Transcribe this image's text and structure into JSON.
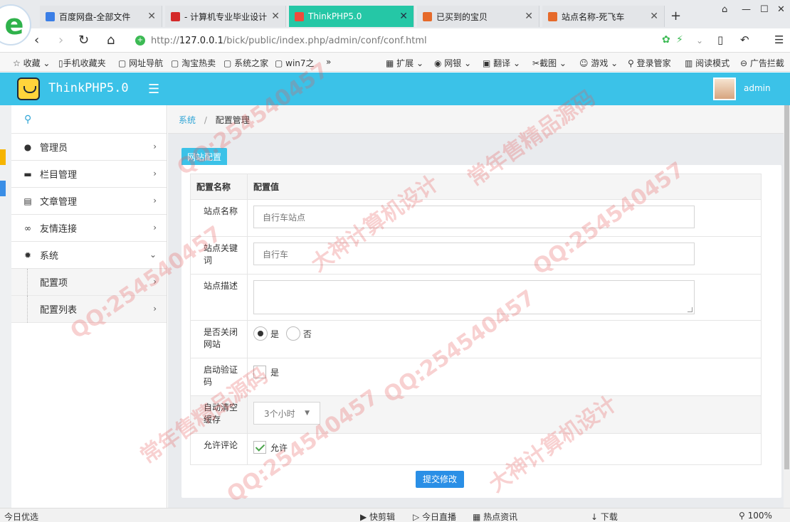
{
  "browser": {
    "tabs": [
      {
        "label": "百度网盘-全部文件",
        "icon": "cloud-icon",
        "active": false
      },
      {
        "label": "- 计算机专业毕业设计",
        "icon": "site-icon",
        "active": false
      },
      {
        "label": "ThinkPHP5.0",
        "icon": "thinkphp-icon",
        "active": true
      },
      {
        "label": "已买到的宝贝",
        "icon": "taobao-icon",
        "active": false
      },
      {
        "label": "站点名称-死飞车",
        "icon": "site-icon",
        "active": false
      }
    ],
    "url": {
      "host": "127.0.0.1",
      "prefix": "http://",
      "path": "/bick/public/index.php/admin/conf/conf.html"
    },
    "bookmarks": [
      "收藏",
      "手机收藏夹",
      "网址导航",
      "淘宝热卖",
      "系统之家",
      "win7之",
      "»",
      "扩展",
      "网银",
      "翻译",
      "截图",
      "游戏",
      "登录管家",
      "阅读模式",
      "广告拦截"
    ]
  },
  "app": {
    "brand": "ThinkPHP5.0",
    "user": "admin"
  },
  "sidebar": {
    "items": [
      {
        "label": "管理员",
        "icon": "user-icon"
      },
      {
        "label": "栏目管理",
        "icon": "folder-icon"
      },
      {
        "label": "文章管理",
        "icon": "document-icon"
      },
      {
        "label": "友情连接",
        "icon": "link-icon"
      },
      {
        "label": "系统",
        "icon": "gear-icon"
      }
    ],
    "sub_items": [
      {
        "label": "配置项"
      },
      {
        "label": "配置列表"
      }
    ]
  },
  "breadcrumb": {
    "root": "系统",
    "separator": "/",
    "current": "配置管理"
  },
  "panel": {
    "tab": "网站配置",
    "headers": {
      "name": "配置名称",
      "value": "配置值"
    },
    "rows": {
      "site_name": {
        "label": "站点名称",
        "value": "自行车站点"
      },
      "site_keywords": {
        "label": "站点关键词",
        "value": "自行车"
      },
      "site_desc": {
        "label": "站点描述",
        "value": ""
      },
      "close_site": {
        "label": "是否关闭网站",
        "options": [
          "是",
          "否"
        ],
        "selected": "是"
      },
      "captcha": {
        "label": "启动验证码",
        "option": "是",
        "checked": false
      },
      "cache": {
        "label": "自动清空缓存",
        "value": "3个小时"
      },
      "comment": {
        "label": "允许评论",
        "option": "允许",
        "checked": true
      }
    },
    "submit": "提交修改"
  },
  "statusbar": {
    "left": "今日优选",
    "items": [
      "快剪辑",
      "今日直播",
      "热点资讯",
      "下载",
      "100%"
    ]
  },
  "watermarks": [
    "QQ:254540457",
    "常年售精品源码",
    "大神计算机设计"
  ]
}
